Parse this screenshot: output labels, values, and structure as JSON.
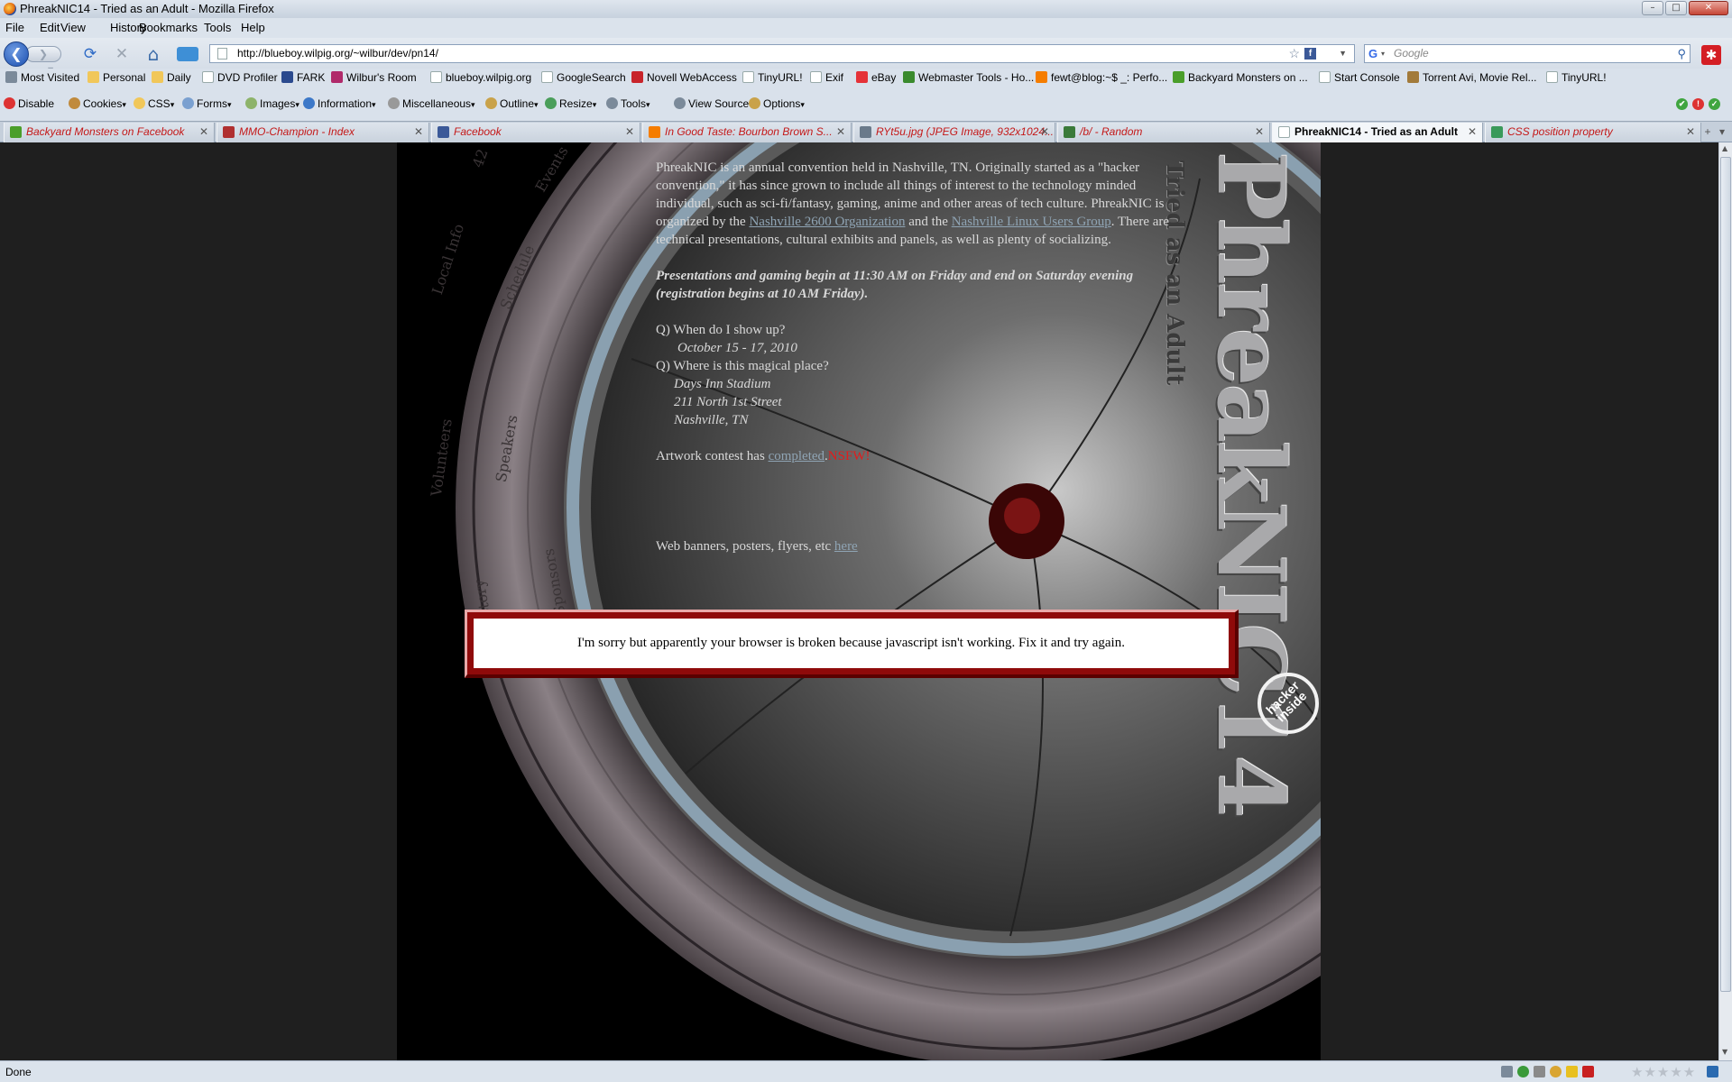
{
  "window": {
    "title": "PhreakNIC14 - Tried as an Adult - Mozilla Firefox",
    "minimize": "–",
    "maximize": "□",
    "close": "✕"
  },
  "menu": [
    "File",
    "Edit",
    "View",
    "History",
    "Bookmarks",
    "Tools",
    "Help"
  ],
  "nav": {
    "url": "http://blueboy.wilpig.org/~wilbur/dev/pn14/",
    "search_placeholder": "Google",
    "back_glyph": "❮",
    "forward_glyph": "❯",
    "reload_glyph": "⟳",
    "stop_glyph": "✕",
    "home_glyph": "⌂"
  },
  "bookmarks": [
    {
      "label": "Most Visited",
      "icon": "gear-icon",
      "color": "#7b8a9a"
    },
    {
      "label": "Personal",
      "icon": "folder-icon",
      "color": "#f1c75a"
    },
    {
      "label": "Daily",
      "icon": "folder-icon",
      "color": "#f1c75a"
    },
    {
      "label": "DVD Profiler",
      "icon": "page-icon",
      "color": "#ffffff"
    },
    {
      "label": "FARK",
      "icon": "fark-icon",
      "color": "#2b4a8e"
    },
    {
      "label": "Wilbur's Room",
      "icon": "pig-icon",
      "color": "#b02a6a"
    },
    {
      "label": "blueboy.wilpig.org",
      "icon": "page-icon",
      "color": "#ffffff"
    },
    {
      "label": "GoogleSearch",
      "icon": "page-icon",
      "color": "#ffffff"
    },
    {
      "label": "Novell WebAccess",
      "icon": "novell-icon",
      "color": "#c8242b"
    },
    {
      "label": "TinyURL!",
      "icon": "page-icon",
      "color": "#ffffff"
    },
    {
      "label": "Exif",
      "icon": "page-icon",
      "color": "#ffffff"
    },
    {
      "label": "eBay",
      "icon": "ebay-icon",
      "color": "#e53238"
    },
    {
      "label": "Webmaster Tools - Ho...",
      "icon": "webmaster-icon",
      "color": "#3a8a2d"
    },
    {
      "label": "fewt@blog:~$ _: Perfo...",
      "icon": "blogger-icon",
      "color": "#f57d00"
    },
    {
      "label": "Backyard Monsters on ...",
      "icon": "monster-icon",
      "color": "#4a9e2a"
    },
    {
      "label": "Start Console",
      "icon": "page-icon",
      "color": "#ffffff"
    },
    {
      "label": "Torrent Avi, Movie Rel...",
      "icon": "film-icon",
      "color": "#a27a3a"
    },
    {
      "label": "TinyURL!",
      "icon": "page-icon",
      "color": "#ffffff"
    }
  ],
  "devtools": [
    {
      "label": "Disable",
      "icon": "disable-icon",
      "color": "#d33"
    },
    {
      "label": "Cookies",
      "icon": "cookie-icon",
      "color": "#c08a3c"
    },
    {
      "label": "CSS",
      "icon": "css-icon",
      "color": "#f1c75a"
    },
    {
      "label": "Forms",
      "icon": "forms-icon",
      "color": "#7aa0d0"
    },
    {
      "label": "Images",
      "icon": "images-icon",
      "color": "#8db36a"
    },
    {
      "label": "Information",
      "icon": "info-icon",
      "color": "#3c78c8"
    },
    {
      "label": "Miscellaneous",
      "icon": "misc-icon",
      "color": "#999"
    },
    {
      "label": "Outline",
      "icon": "outline-icon",
      "color": "#c9a24a"
    },
    {
      "label": "Resize",
      "icon": "resize-icon",
      "color": "#4a9e5a"
    },
    {
      "label": "Tools",
      "icon": "tools-icon",
      "color": "#7b8a9a"
    },
    {
      "label": "View Source",
      "icon": "source-icon",
      "color": "#7b8a9a"
    },
    {
      "label": "Options",
      "icon": "options-icon",
      "color": "#c9a24a"
    }
  ],
  "tabs": [
    {
      "label": "Backyard Monsters on Facebook",
      "icon": "monster-icon",
      "color": "#4a9e2a",
      "active": false
    },
    {
      "label": "MMO-Champion - Index",
      "icon": "mmo-icon",
      "color": "#b03030",
      "active": false
    },
    {
      "label": "Facebook",
      "icon": "facebook-icon",
      "color": "#3b5998",
      "active": false
    },
    {
      "label": "In Good Taste: Bourbon Brown S...",
      "icon": "blogger-icon",
      "color": "#f57d00",
      "active": false
    },
    {
      "label": "RYt5u.jpg (JPEG Image, 932x1024...",
      "icon": "image-icon",
      "color": "#6a7a8a",
      "active": false
    },
    {
      "label": "/b/ - Random",
      "icon": "clover-icon",
      "color": "#3a7a3a",
      "active": false
    },
    {
      "label": "PhreakNIC14 - Tried as an Adult",
      "icon": "page-icon",
      "color": "#ffffff",
      "active": true
    },
    {
      "label": "CSS position property",
      "icon": "w3-icon",
      "color": "#3a9a5a",
      "active": false
    }
  ],
  "page": {
    "logo_title": "PhreakNIC14",
    "logo_subtitle": "Tried as an Adult",
    "badge": "hacker inside",
    "ring_labels": [
      "42",
      "Events",
      "Local Info",
      "Schedule",
      "Volunteers",
      "Speakers",
      "History",
      "Sponsors"
    ],
    "intro_pre": "PhreakNIC is an annual convention held in Nashville, TN. Originally started as a \"hacker convention,\" it has since grown to include all things of interest to the technology minded individual, such as sci-fi/fantasy, gaming, anime and other areas of tech culture. PhreakNIC is organized by the ",
    "link_2600": "Nashville 2600 Organization",
    "intro_and": " and the ",
    "link_lug": "Nashville Linux Users Group",
    "intro_post": ". There are technical presentations, cultural exhibits and panels, as well as plenty of socializing.",
    "presentations": "Presentations and gaming begin at 11:30 AM on Friday and end on Saturday evening (registration begins at 10 AM Friday).",
    "q1": "Q) When do I show up?",
    "a1": "October 15 - 17, 2010",
    "q2": "Q) Where is this magical place?",
    "addr1": "Days Inn Stadium",
    "addr2": "211 North 1st Street",
    "addr3": "Nashville, TN",
    "artwork_pre": "Artwork contest has ",
    "artwork_link": "completed",
    "artwork_dot": ".",
    "artwork_nsfw": "NSFW!",
    "banners_pre": "Web banners, posters, flyers, etc ",
    "banners_link": "here",
    "overlay_message": "I'm sorry but apparently your browser is broken because javascript isn't working. Fix it and try again."
  },
  "status": {
    "text": "Done",
    "rating_stars": "★★★★★"
  }
}
